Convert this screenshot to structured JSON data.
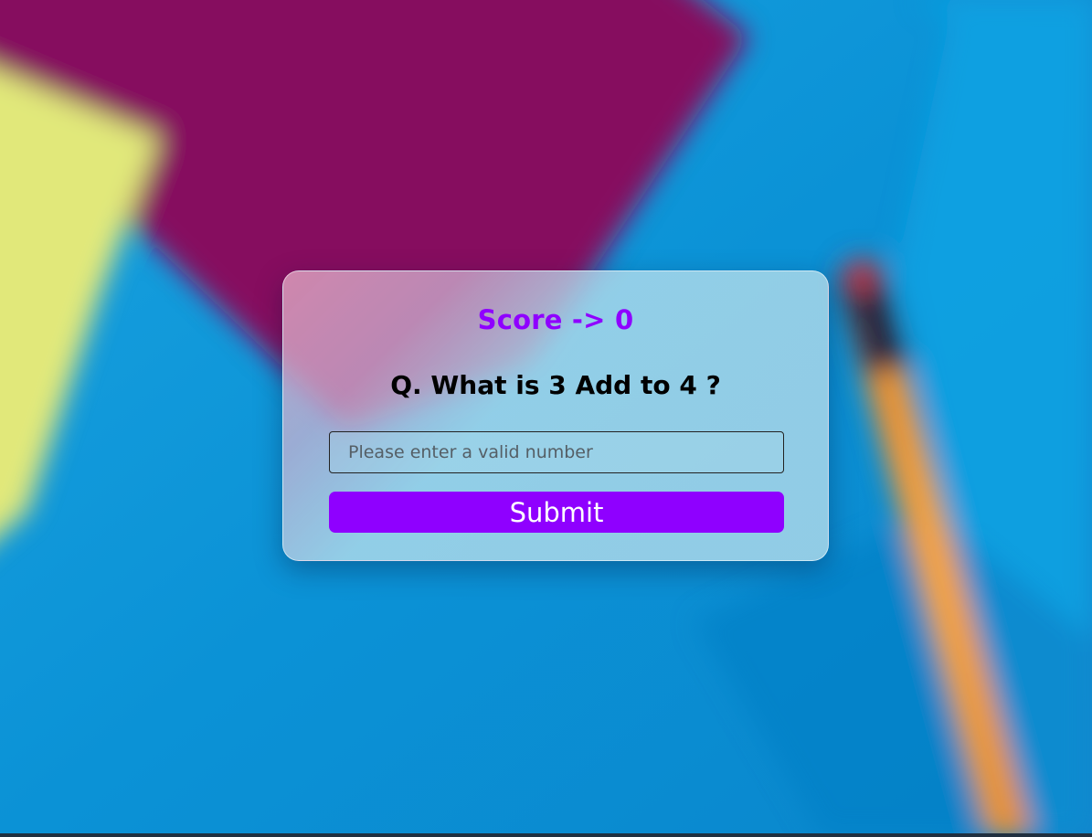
{
  "quiz": {
    "score_label": "Score -> 0",
    "question": "Q. What is 3 Add to 4 ?",
    "answer_placeholder": "Please enter a valid number",
    "answer_value": "",
    "submit_label": "Submit"
  },
  "colors": {
    "accent": "#8f00ff",
    "background_blue": "#0a93d6",
    "background_magenta": "#86085e",
    "background_yellow": "#e1e87a",
    "pencil_orange": "#f39c3d"
  }
}
